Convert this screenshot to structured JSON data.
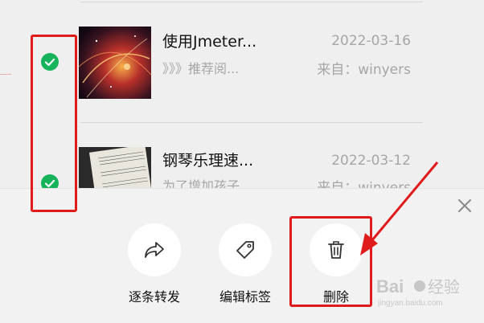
{
  "items": [
    {
      "title": "使用Jmeter...",
      "preview": "》》》推荐阅...",
      "date": "2022-03-16",
      "source": "来自：winyers",
      "selected": true,
      "thumb_icon": "galaxy-thumbnail"
    },
    {
      "title": "钢琴乐理速...",
      "preview": "为了增加孩子...",
      "date": "2022-03-12",
      "source": "来自：winyers",
      "selected": true,
      "thumb_icon": "sheet-music-thumbnail"
    }
  ],
  "actions": [
    {
      "label": "逐条转发",
      "icon": "forward-icon"
    },
    {
      "label": "编辑标签",
      "icon": "tag-icon"
    },
    {
      "label": "删除",
      "icon": "trash-icon"
    }
  ],
  "close_icon": "close-icon",
  "colors": {
    "check_green": "#17b35a",
    "highlight_red": "#e01b1b",
    "sheet_bg": "#f2f2f2",
    "list_bg": "#efefef"
  },
  "watermark": {
    "brand": "Bai",
    "paw": "du",
    "suffix": "经验",
    "url": "jingyan.baidu.com"
  }
}
